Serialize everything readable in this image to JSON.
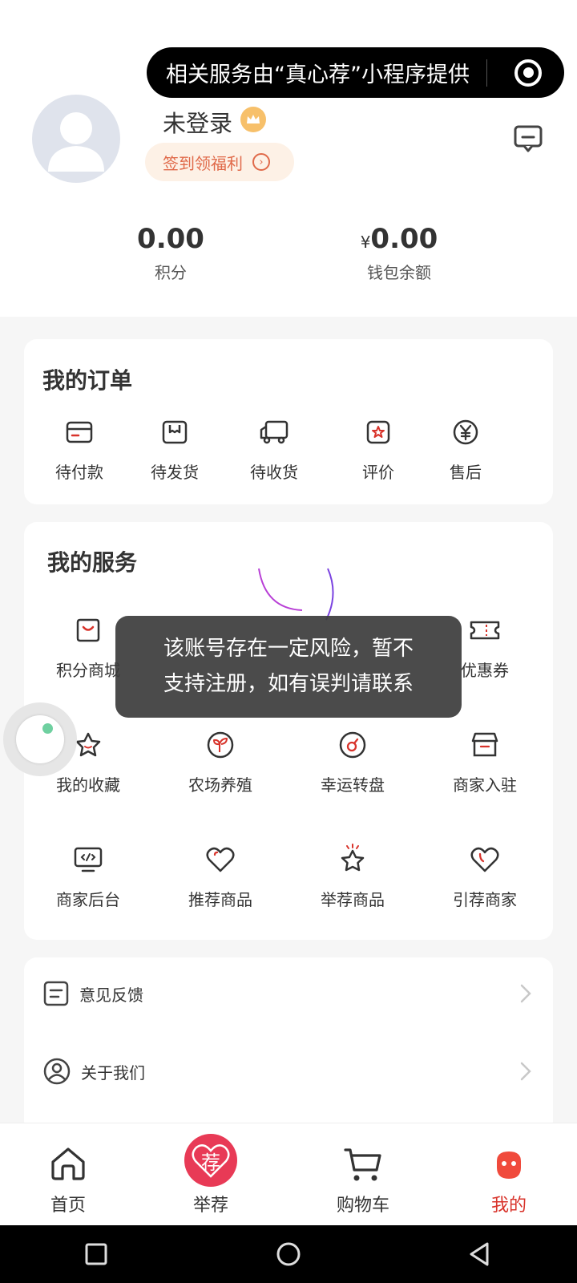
{
  "miniprogram_banner": "相关服务由“真心荐”小程序提供",
  "user": {
    "name": "未登录",
    "signin_label": "签到领福利"
  },
  "stats": [
    {
      "value": "0.00",
      "prefix": "",
      "label": "积分"
    },
    {
      "value": "0.00",
      "prefix": "¥",
      "label": "钱包余额"
    }
  ],
  "orders": {
    "title": "我的订单",
    "items": [
      {
        "label": "待付款",
        "icon": "card-icon"
      },
      {
        "label": "待发货",
        "icon": "package-icon"
      },
      {
        "label": "待收货",
        "icon": "truck-icon"
      },
      {
        "label": "评价",
        "icon": "star-square-icon"
      },
      {
        "label": "售后",
        "icon": "yuan-circle-icon"
      }
    ]
  },
  "services": {
    "title": "我的服务",
    "items": [
      {
        "label": "积分商城",
        "icon": "shopping-bag-icon"
      },
      {
        "label": "",
        "icon": ""
      },
      {
        "label": "",
        "icon": ""
      },
      {
        "label": "优惠券",
        "icon": "ticket-icon"
      },
      {
        "label": "我的收藏",
        "icon": "star-icon"
      },
      {
        "label": "农场养殖",
        "icon": "sprout-icon"
      },
      {
        "label": "幸运转盘",
        "icon": "spinner-icon"
      },
      {
        "label": "商家入驻",
        "icon": "store-icon"
      },
      {
        "label": "商家后台",
        "icon": "monitor-code-icon"
      },
      {
        "label": "推荐商品",
        "icon": "heart-icon"
      },
      {
        "label": "举荐商品",
        "icon": "star-spark-icon"
      },
      {
        "label": "引荐商家",
        "icon": "heart-icon"
      }
    ]
  },
  "list": [
    {
      "label": "意见反馈",
      "icon": "feedback-doc-icon"
    },
    {
      "label": "关于我们",
      "icon": "user-circle-icon"
    }
  ],
  "toast": {
    "line1": "该账号存在一定风险，暂不",
    "line2": "支持注册，如有误判请联系"
  },
  "tabs": [
    {
      "label": "首页",
      "icon": "home-icon",
      "active": false
    },
    {
      "label": "举荐",
      "icon": "recommend-heart-icon",
      "badge_char": "荐",
      "active": false
    },
    {
      "label": "购物车",
      "icon": "cart-icon",
      "active": false
    },
    {
      "label": "我的",
      "icon": "profile-face-icon",
      "active": true
    }
  ],
  "colors": {
    "accent": "#d8332b",
    "signin_text": "#e06a4a",
    "crown": "#f7c06a"
  }
}
